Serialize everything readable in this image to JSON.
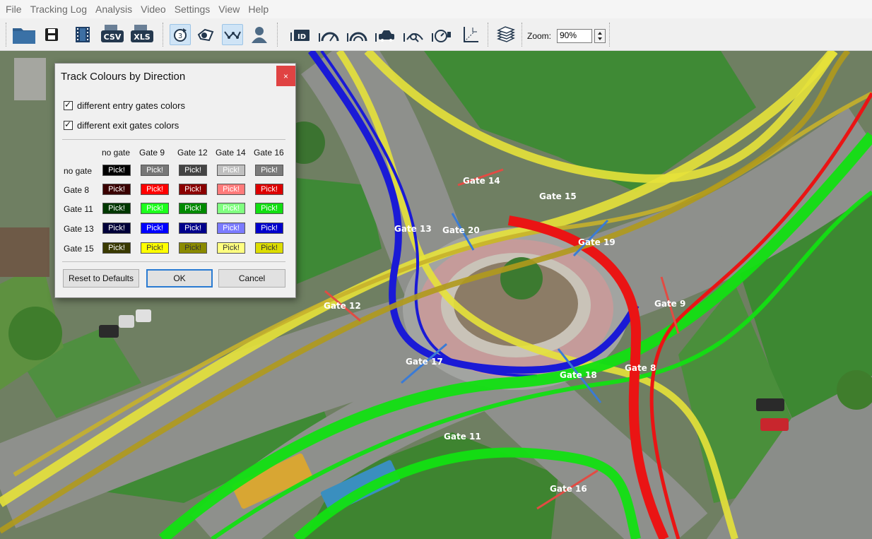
{
  "menu": [
    "File",
    "Tracking Log",
    "Analysis",
    "Video",
    "Settings",
    "View",
    "Help"
  ],
  "toolbar": {
    "zoom_label": "Zoom:",
    "zoom_value": "90%",
    "csv_label": "CSV",
    "xls_label": "XLS",
    "id_label": "ID"
  },
  "gates": {
    "g14": "Gate 14",
    "g15": "Gate 15",
    "g13": "Gate 13",
    "g20": "Gate 20",
    "g19": "Gate 19",
    "g12": "Gate 12",
    "g9": "Gate 9",
    "g17": "Gate 17",
    "g18": "Gate 18",
    "g8": "Gate 8",
    "g11": "Gate 11",
    "g16": "Gate 16"
  },
  "dialog": {
    "title": "Track Colours by Direction",
    "close": "×",
    "entry_label": "different entry gates colors",
    "exit_label": "different exit gates colors",
    "columns": [
      "no gate",
      "Gate 9",
      "Gate 12",
      "Gate 14",
      "Gate 16"
    ],
    "rows": [
      "no gate",
      "Gate 8",
      "Gate 11",
      "Gate 13",
      "Gate 15"
    ],
    "pick_label": "Pick!",
    "reset": "Reset to Defaults",
    "ok": "OK",
    "cancel": "Cancel"
  }
}
